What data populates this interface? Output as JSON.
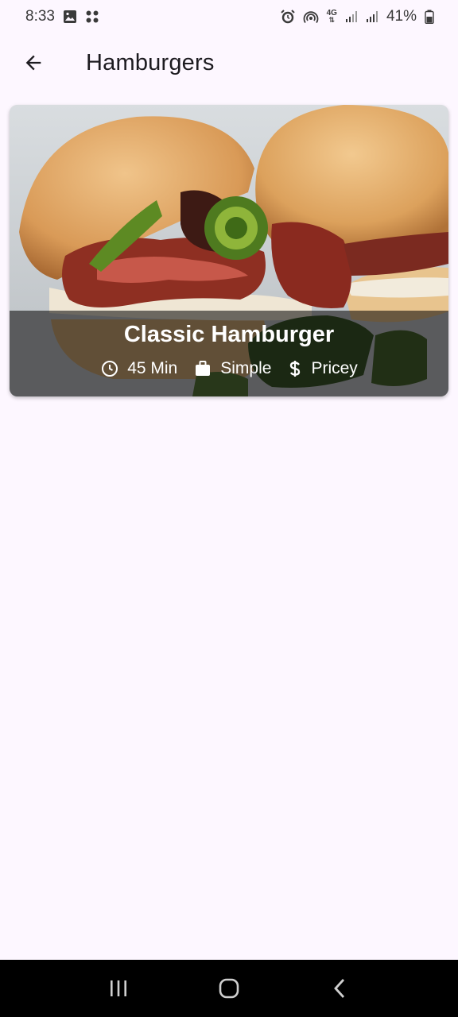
{
  "status_bar": {
    "time": "8:33",
    "battery": "41%",
    "network": "4G",
    "icons_left": [
      "gallery-icon",
      "app-grid-icon"
    ],
    "icons_right": [
      "alarm-icon",
      "hotspot-icon",
      "network-4g-icon",
      "signal-icon",
      "signal-icon",
      "battery-icon"
    ]
  },
  "app_bar": {
    "title": "Hamburgers",
    "back_icon": "arrow-left-icon"
  },
  "meals": [
    {
      "title": "Classic Hamburger",
      "duration": "45 Min",
      "complexity": "Simple",
      "affordability": "Pricey",
      "icons": [
        "clock-icon",
        "briefcase-icon",
        "dollar-icon"
      ]
    }
  ],
  "nav_bar": {
    "icons": [
      "recent-apps-icon",
      "home-icon",
      "back-icon"
    ]
  },
  "colors": {
    "background": "#fdf7ff",
    "overlay": "#000000",
    "nav_bar": "#000000",
    "text_primary": "#1d1b20"
  }
}
